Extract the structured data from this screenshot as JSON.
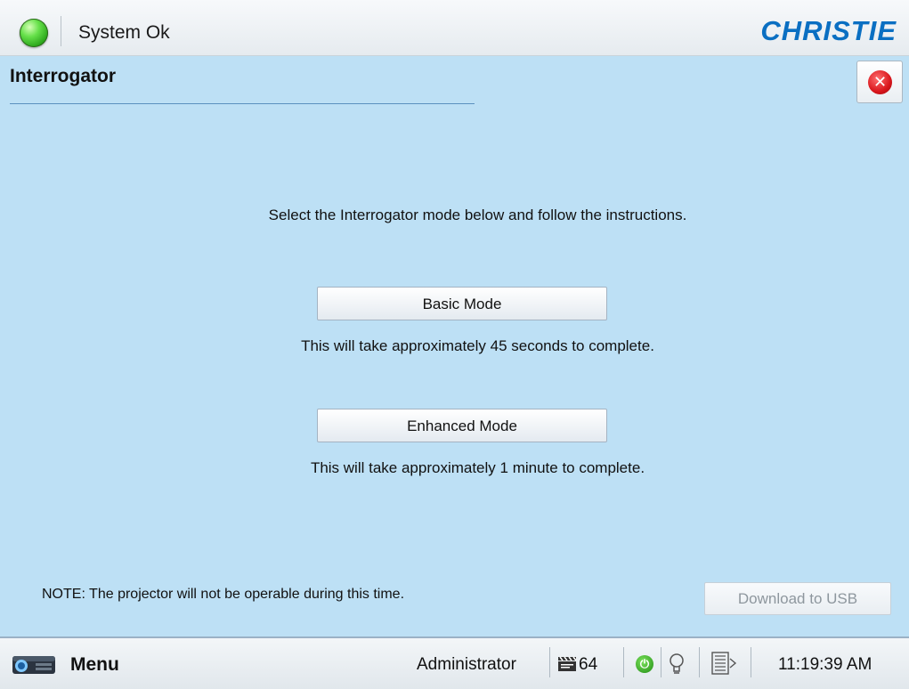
{
  "header": {
    "status_text": "System Ok",
    "status_color": "#2fbf1c",
    "brand": "CHRISTIE",
    "brand_color": "#0a6fc2"
  },
  "page": {
    "title": "Interrogator",
    "close_icon": "close-icon"
  },
  "content": {
    "instruction": "Select the Interrogator mode below and follow the instructions.",
    "basic_button": "Basic Mode",
    "basic_note": "This will take approximately 45 seconds to complete.",
    "enhanced_button": "Enhanced Mode",
    "enhanced_note": "This will take approximately 1 minute to complete.",
    "footnote": "NOTE: The projector will not be operable during this time.",
    "download_button": "Download to USB",
    "download_enabled": false
  },
  "taskbar": {
    "menu_label": "Menu",
    "user": "Administrator",
    "channel": "64",
    "icons": [
      "projector-icon",
      "slate-icon",
      "power-icon",
      "lamp-icon",
      "dowser-icon"
    ],
    "time": "11:19:39 AM"
  }
}
